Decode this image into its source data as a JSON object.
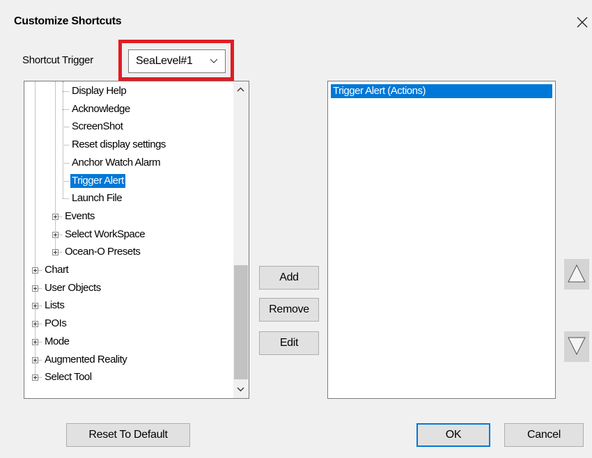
{
  "window": {
    "title": "Customize Shortcuts"
  },
  "trigger": {
    "label": "Shortcut Trigger",
    "value": "SeaLevel#1"
  },
  "tree": {
    "items": [
      {
        "label": "Display Help",
        "level": 2,
        "expandable": false,
        "selected": false
      },
      {
        "label": "Acknowledge",
        "level": 2,
        "expandable": false,
        "selected": false
      },
      {
        "label": "ScreenShot",
        "level": 2,
        "expandable": false,
        "selected": false
      },
      {
        "label": "Reset display settings",
        "level": 2,
        "expandable": false,
        "selected": false
      },
      {
        "label": "Anchor Watch Alarm",
        "level": 2,
        "expandable": false,
        "selected": false
      },
      {
        "label": "Trigger Alert",
        "level": 2,
        "expandable": false,
        "selected": true
      },
      {
        "label": "Launch File",
        "level": 2,
        "expandable": false,
        "selected": false
      },
      {
        "label": "Events",
        "level": 1,
        "expandable": true,
        "selected": false
      },
      {
        "label": "Select WorkSpace",
        "level": 1,
        "expandable": true,
        "selected": false
      },
      {
        "label": "Ocean-O Presets",
        "level": 1,
        "expandable": true,
        "selected": false
      },
      {
        "label": "Chart",
        "level": 0,
        "expandable": true,
        "selected": false
      },
      {
        "label": "User Objects",
        "level": 0,
        "expandable": true,
        "selected": false
      },
      {
        "label": "Lists",
        "level": 0,
        "expandable": true,
        "selected": false
      },
      {
        "label": "POIs",
        "level": 0,
        "expandable": true,
        "selected": false
      },
      {
        "label": "Mode",
        "level": 0,
        "expandable": true,
        "selected": false
      },
      {
        "label": "Augmented Reality",
        "level": 0,
        "expandable": true,
        "selected": false
      },
      {
        "label": "Select Tool",
        "level": 0,
        "expandable": true,
        "selected": false
      }
    ]
  },
  "buttons": {
    "add": "Add",
    "remove": "Remove",
    "edit": "Edit",
    "reset": "Reset To Default",
    "ok": "OK",
    "cancel": "Cancel"
  },
  "actions": {
    "items": [
      "Trigger Alert (Actions)"
    ]
  },
  "icons": {
    "close": "close-icon",
    "dropdown": "chevron-down-icon",
    "scroll_up": "scroll-up-icon",
    "scroll_down": "scroll-down-icon",
    "move_up": "triangle-up-icon",
    "move_down": "triangle-down-icon",
    "expander": "plus-box-icon"
  },
  "colors": {
    "highlight_border": "#e21c23",
    "selection": "#0078d7",
    "dialog_bg": "#f0f0f0"
  }
}
